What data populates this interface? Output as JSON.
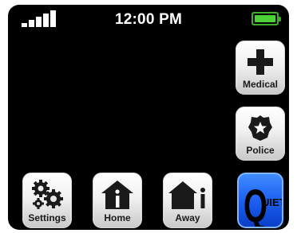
{
  "status_bar": {
    "time": "12:00 PM"
  },
  "buttons": {
    "medical": {
      "label": "Medical"
    },
    "police": {
      "label": "Police"
    },
    "settings": {
      "label": "Settings"
    },
    "home": {
      "label": "Home"
    },
    "away": {
      "label": "Away"
    },
    "quiet": {
      "letter": "Q",
      "rest": "UIET"
    }
  },
  "colors": {
    "screen_background": "#000000",
    "battery": "#4cd137",
    "quiet_button": "#1a5cf0",
    "icon": "#1a1a1a"
  }
}
